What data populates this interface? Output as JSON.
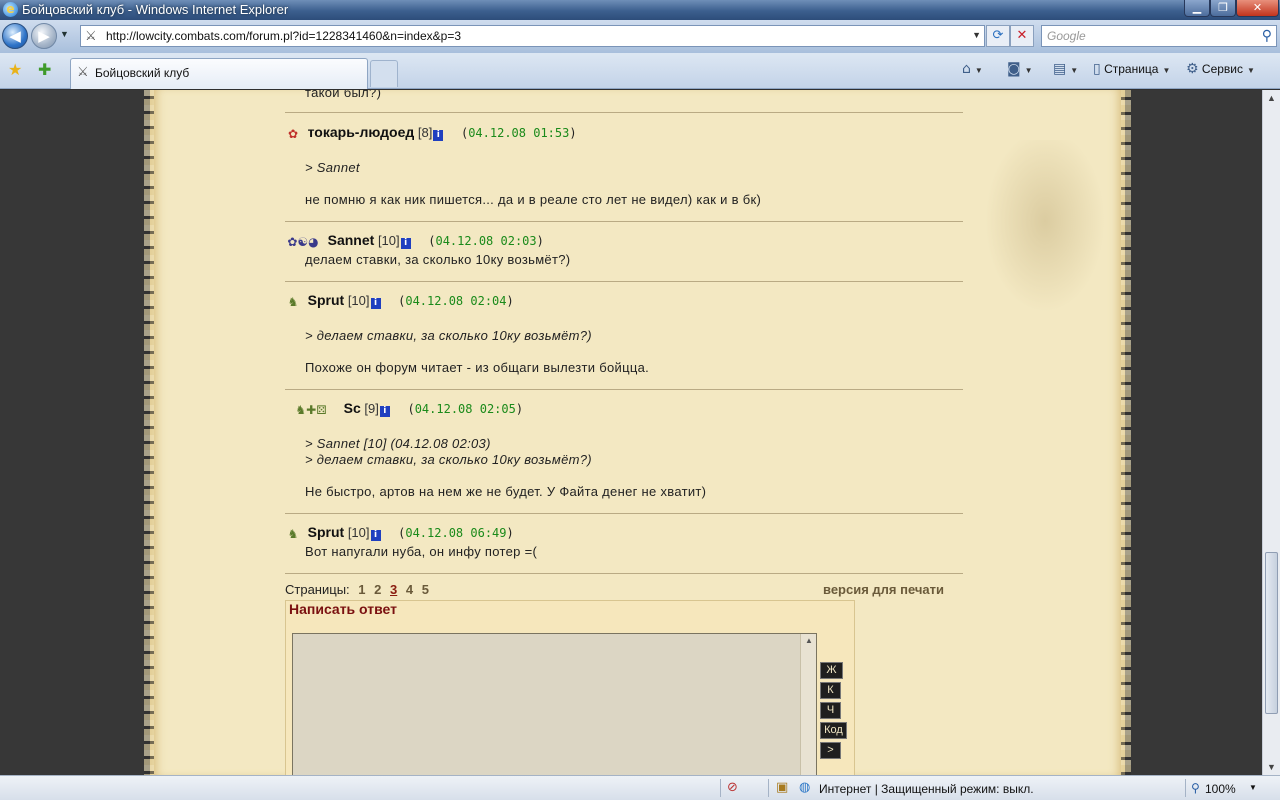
{
  "window": {
    "title": "Бойцовский клуб - Windows Internet Explorer",
    "min_glyph": "▁",
    "max_glyph": "❐",
    "close_glyph": "✕"
  },
  "address": {
    "back_glyph": "◀",
    "forward_glyph": "▶",
    "url": "http://lowcity.combats.com/forum.pl?id=1228341460&n=index&p=3",
    "search_placeholder": "Google"
  },
  "tab": {
    "title": "Бойцовский клуб"
  },
  "commands": {
    "page": "Страница",
    "tools": "Сервис"
  },
  "forum": {
    "top_fragment": "такой был?)",
    "posts": [
      {
        "nick": "токарь-людоед",
        "level": "[8]",
        "date": "04.12.08 01:53",
        "align_icons": "✿",
        "quote": "> Sannet",
        "text": "не помню я как ник пишется... да и в реале сто лет не видел) как и в бк)"
      },
      {
        "nick": "Sannet",
        "level": "[10]",
        "date": "04.12.08 02:03",
        "align_icons": "✿☯◕",
        "text": "делаем ставки, за сколько 10ку возьмёт?)"
      },
      {
        "nick": "Sprut",
        "level": "[10]",
        "date": "04.12.08 02:04",
        "align_icons": "♞",
        "quote": "> делаем ставки, за сколько 10ку возьмёт?)",
        "text": "Похоже он форум читает - из общаги вылезти бойцца."
      },
      {
        "nick": "Sc",
        "level": "[9]",
        "date": "04.12.08 02:05",
        "align_icons": "♞✚⚄",
        "quote1": "> Sannet [10]   (04.12.08 02:03)",
        "quote2": "> делаем ставки, за сколько 10ку возьмёт?)",
        "text": "Не быстро, артов на нем же не будет. У Файта денег не хватит)"
      },
      {
        "nick": "Sprut",
        "level": "[10]",
        "date": "04.12.08 06:49",
        "align_icons": "♞",
        "text": "Вот напугали нуба, он инфу потер =("
      }
    ],
    "pages_label": "Страницы:",
    "pages": [
      "1",
      "2",
      "3",
      "4",
      "5"
    ],
    "current_page": "3",
    "print_version": "версия для печати",
    "reply_title": "Написать ответ",
    "format_buttons": [
      "Ж",
      "К",
      "Ч",
      "Код",
      ">"
    ]
  },
  "status": {
    "zone": "Интернет | Защищенный режим: выкл.",
    "zoom": "100%"
  },
  "colors": {
    "parchment": "#f3e8c2",
    "date_green": "#1a8a1a",
    "reply_title": "#7a1010"
  }
}
